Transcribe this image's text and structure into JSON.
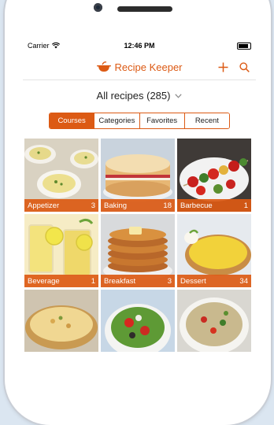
{
  "status": {
    "carrier": "Carrier",
    "time": "12:46 PM"
  },
  "app": {
    "title": "Recipe Keeper"
  },
  "header": {
    "dropdown_label": "All recipes (285)"
  },
  "segments": [
    "Courses",
    "Categories",
    "Favorites",
    "Recent"
  ],
  "active_segment": "Courses",
  "accent": "#dc5a14",
  "tiles": [
    {
      "name": "Appetizer",
      "count": "3"
    },
    {
      "name": "Baking",
      "count": "18"
    },
    {
      "name": "Barbecue",
      "count": "1"
    },
    {
      "name": "Beverage",
      "count": "1"
    },
    {
      "name": "Breakfast",
      "count": "3"
    },
    {
      "name": "Dessert",
      "count": "34"
    },
    {
      "name": "",
      "count": ""
    },
    {
      "name": "",
      "count": ""
    },
    {
      "name": "",
      "count": ""
    }
  ]
}
